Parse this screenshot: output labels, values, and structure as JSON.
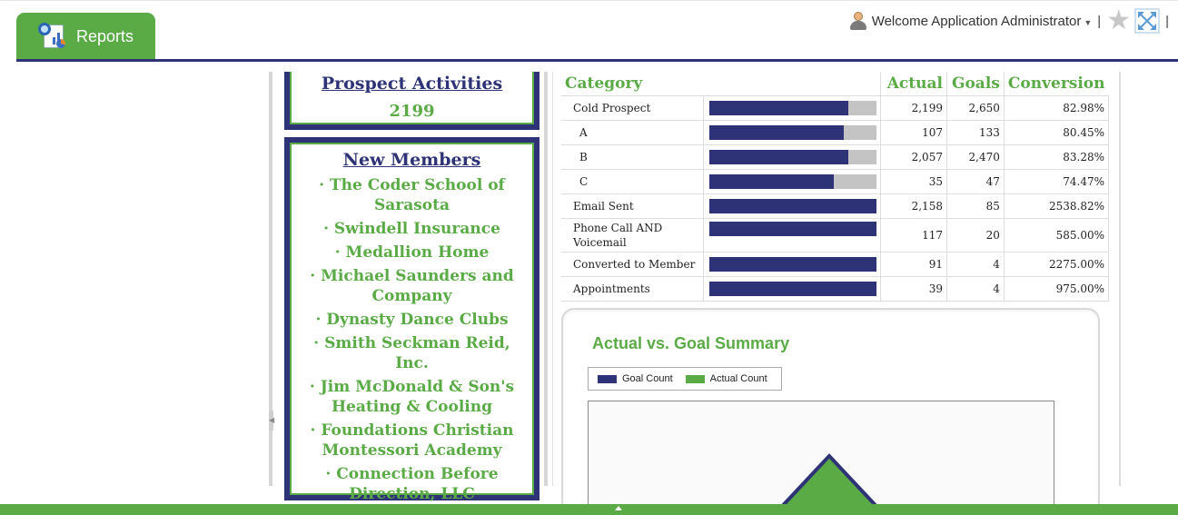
{
  "header": {
    "tab_label": "Reports",
    "welcome": "Welcome Application Administrator",
    "separator": "|"
  },
  "prospect": {
    "title": "Prospect Activities",
    "value": "2199"
  },
  "members": {
    "title": "New Members",
    "items": [
      "· The Coder School of Sarasota",
      "· Swindell Insurance",
      "· Medallion Home",
      "· Michael Saunders and Company",
      "· Dynasty Dance Clubs",
      "· Smith Seckman Reid, Inc.",
      "· Jim McDonald & Son's Heating & Cooling",
      "· Foundations Christian Montessori Academy",
      "· Connection Before Direction, LLC"
    ]
  },
  "table": {
    "headers": {
      "category": "Category",
      "actual": "Actual",
      "goals": "Goals",
      "conversion": "Conversion"
    },
    "rows": [
      {
        "category": "Cold Prospect",
        "actual": "2,199",
        "goals": "2,650",
        "conversion": "82.98%",
        "progress": 0.8298
      },
      {
        "category": "A",
        "actual": "107",
        "goals": "133",
        "conversion": "80.45%",
        "progress": 0.8045
      },
      {
        "category": "B",
        "actual": "2,057",
        "goals": "2,470",
        "conversion": "83.28%",
        "progress": 0.8328
      },
      {
        "category": "C",
        "actual": "35",
        "goals": "47",
        "conversion": "74.47%",
        "progress": 0.7447
      },
      {
        "category": "Email Sent",
        "actual": "2,158",
        "goals": "85",
        "conversion": "2538.82%",
        "progress": 1.0
      },
      {
        "category": "Phone Call AND Voicemail",
        "actual": "117",
        "goals": "20",
        "conversion": "585.00%",
        "progress": 1.0
      },
      {
        "category": "Converted to Member",
        "actual": "91",
        "goals": "4",
        "conversion": "2275.00%",
        "progress": 1.0
      },
      {
        "category": "Appointments",
        "actual": "39",
        "goals": "4",
        "conversion": "975.00%",
        "progress": 1.0
      }
    ]
  },
  "summary": {
    "title": "Actual vs. Goal Summary",
    "legend": [
      {
        "label": "Goal Count",
        "color": "#2e3276"
      },
      {
        "label": "Actual Count",
        "color": "#5aab46"
      }
    ]
  },
  "colors": {
    "brand_green": "#5aab46",
    "brand_navy": "#2e3276",
    "bar_track": "#c4c4c4"
  }
}
